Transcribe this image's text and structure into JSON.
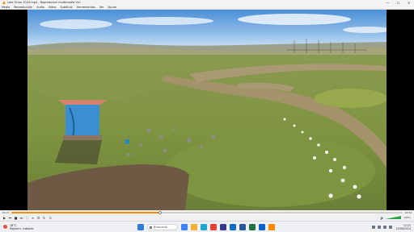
{
  "window": {
    "title": "Lote Orion 2024.mp4 - Reproductor multimedia VLC",
    "minimize": "—",
    "maximize": "☐",
    "close": "✕"
  },
  "menu": {
    "items": [
      "Medio",
      "Reproducción",
      "Audio",
      "Vídeo",
      "Subtítulo",
      "Herramientas",
      "Ver",
      "Ayuda"
    ]
  },
  "playback": {
    "elapsed": "00:17",
    "total": "00:52",
    "progress": 0.38,
    "volume_percent": "100%"
  },
  "taskbar": {
    "weather_temp": "18°C",
    "weather_desc": "Mayorm. nublado",
    "search_placeholder": "Búsqueda",
    "time": "12:21",
    "date": "25/06/2024",
    "app_icons": [
      {
        "name": "windows-start-icon",
        "color": "#2f7fd8"
      },
      {
        "name": "search-icon",
        "color": "#ffffff"
      },
      {
        "name": "widgets-icon",
        "color": "#3b82f6"
      },
      {
        "name": "file-explorer-icon",
        "color": "#f2b233"
      },
      {
        "name": "edge-icon",
        "color": "#1fa8c9"
      },
      {
        "name": "chrome-icon",
        "color": "#e94235"
      },
      {
        "name": "store-icon",
        "color": "#3a3a8a"
      },
      {
        "name": "mail-icon",
        "color": "#0f6cbd"
      },
      {
        "name": "word-icon",
        "color": "#2b579a"
      },
      {
        "name": "excel-icon",
        "color": "#217346"
      },
      {
        "name": "outlook-icon",
        "color": "#0a64d0"
      },
      {
        "name": "vlc-icon",
        "color": "#ff8800"
      }
    ]
  }
}
